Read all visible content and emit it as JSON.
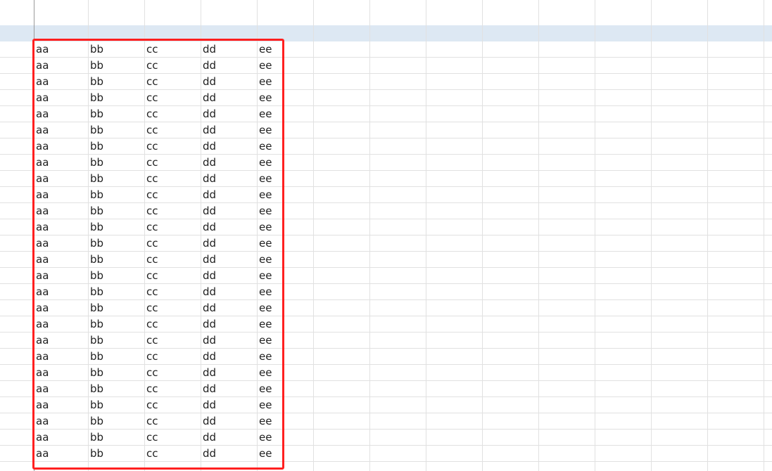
{
  "sheet": {
    "rows": [
      [
        "aa",
        "bb",
        "cc",
        "dd",
        "ee"
      ],
      [
        "aa",
        "bb",
        "cc",
        "dd",
        "ee"
      ],
      [
        "aa",
        "bb",
        "cc",
        "dd",
        "ee"
      ],
      [
        "aa",
        "bb",
        "cc",
        "dd",
        "ee"
      ],
      [
        "aa",
        "bb",
        "cc",
        "dd",
        "ee"
      ],
      [
        "aa",
        "bb",
        "cc",
        "dd",
        "ee"
      ],
      [
        "aa",
        "bb",
        "cc",
        "dd",
        "ee"
      ],
      [
        "aa",
        "bb",
        "cc",
        "dd",
        "ee"
      ],
      [
        "aa",
        "bb",
        "cc",
        "dd",
        "ee"
      ],
      [
        "aa",
        "bb",
        "cc",
        "dd",
        "ee"
      ],
      [
        "aa",
        "bb",
        "cc",
        "dd",
        "ee"
      ],
      [
        "aa",
        "bb",
        "cc",
        "dd",
        "ee"
      ],
      [
        "aa",
        "bb",
        "cc",
        "dd",
        "ee"
      ],
      [
        "aa",
        "bb",
        "cc",
        "dd",
        "ee"
      ],
      [
        "aa",
        "bb",
        "cc",
        "dd",
        "ee"
      ],
      [
        "aa",
        "bb",
        "cc",
        "dd",
        "ee"
      ],
      [
        "aa",
        "bb",
        "cc",
        "dd",
        "ee"
      ],
      [
        "aa",
        "bb",
        "cc",
        "dd",
        "ee"
      ],
      [
        "aa",
        "bb",
        "cc",
        "dd",
        "ee"
      ],
      [
        "aa",
        "bb",
        "cc",
        "dd",
        "ee"
      ],
      [
        "aa",
        "bb",
        "cc",
        "dd",
        "ee"
      ],
      [
        "aa",
        "bb",
        "cc",
        "dd",
        "ee"
      ],
      [
        "aa",
        "bb",
        "cc",
        "dd",
        "ee"
      ],
      [
        "aa",
        "bb",
        "cc",
        "dd",
        "ee"
      ],
      [
        "aa",
        "bb",
        "cc",
        "dd",
        "ee"
      ],
      [
        "aa",
        "bb",
        "cc",
        "dd",
        "ee"
      ]
    ]
  },
  "colors": {
    "gridline": "#e1e1e1",
    "frozen_divider": "#9a9a9a",
    "selected_row": "#dde8f3",
    "selection_outline": "#ff2020",
    "text": "#1f1f1f"
  }
}
